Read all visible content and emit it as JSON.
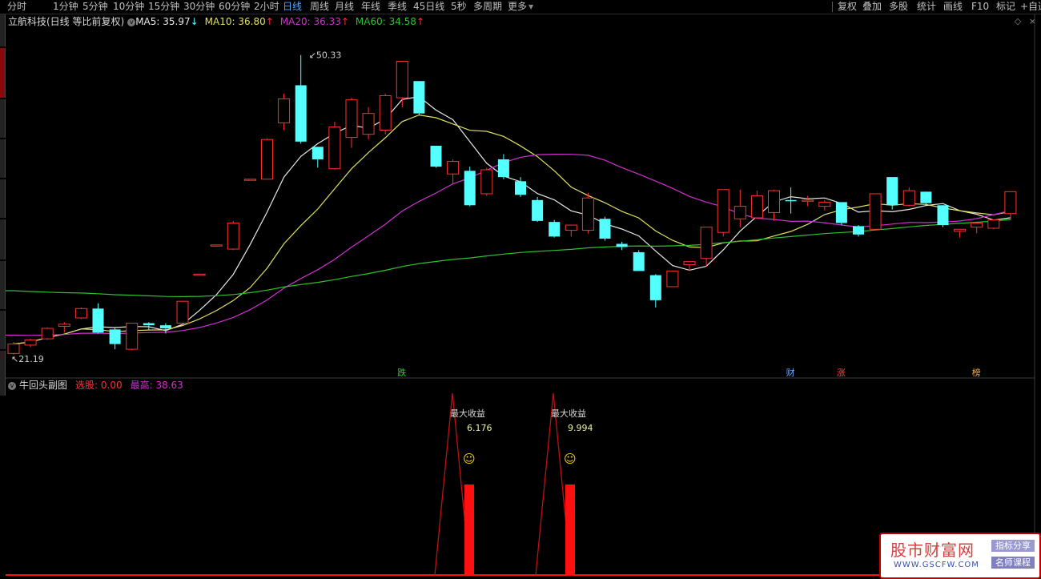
{
  "toolbar": {
    "periods": [
      "分时",
      "1分钟",
      "5分钟",
      "10分钟",
      "15分钟",
      "30分钟",
      "60分钟",
      "2小时",
      "日线",
      "周线",
      "月线",
      "年线",
      "季线",
      "45日线",
      "5秒",
      "多周期",
      "更多"
    ],
    "active_period": "日线",
    "right_buttons": [
      "复权",
      "叠加",
      "多股",
      "统计",
      "画线",
      "F10",
      "标记",
      "+自选"
    ]
  },
  "stock": {
    "name": "立航科技(日线 等比前复权)",
    "ma5_label": "MA5: 35.97",
    "ma5_arrow": "↓",
    "ma10_label": "MA10: 36.80",
    "ma10_arrow": "↑",
    "ma20_label": "MA20: 36.33",
    "ma20_arrow": "↑",
    "ma60_label": "MA60: 34.58",
    "ma60_arrow": "↑"
  },
  "sub_indicator": {
    "name": "牛回头副图",
    "select_label": "选股: 0.00",
    "high_label": "最高: 38.63"
  },
  "colors": {
    "up": "#ff3030",
    "down": "#54ffff",
    "ma5": "#e8e8e8",
    "ma10": "#e0e060",
    "ma20": "#d030d0",
    "ma60": "#30c030",
    "sub_bar": "#ff1010"
  },
  "chart_data": {
    "type": "candlestick",
    "price_range": [
      19.5,
      52.5
    ],
    "high_label": "50.33",
    "low_label": "21.19",
    "candles": [
      [
        21.7,
        22.6,
        21.6,
        22.8
      ],
      [
        22.5,
        23.0,
        22.3,
        23.1
      ],
      [
        23.1,
        24.1,
        23.0,
        24.2
      ],
      [
        24.3,
        24.5,
        23.7,
        24.7
      ],
      [
        25.1,
        26.0,
        25.0,
        26.1
      ],
      [
        26.0,
        23.7,
        23.6,
        26.5
      ],
      [
        24.0,
        22.6,
        22.1,
        24.2
      ],
      [
        22.1,
        24.6,
        22.0,
        24.6
      ],
      [
        24.6,
        24.4,
        23.9,
        24.7
      ],
      [
        24.4,
        24.1,
        23.6,
        24.6
      ],
      [
        24.6,
        26.7,
        24.4,
        26.7
      ],
      [
        29.3,
        29.3,
        29.3,
        29.3
      ],
      [
        32.1,
        32.1,
        32.1,
        32.1
      ],
      [
        31.7,
        34.2,
        31.6,
        34.4
      ],
      [
        38.4,
        38.4,
        38.4,
        38.4
      ],
      [
        38.4,
        42.2,
        38.4,
        42.3
      ],
      [
        43.8,
        46.1,
        43.1,
        46.6
      ],
      [
        47.4,
        42.0,
        41.8,
        50.3
      ],
      [
        41.5,
        40.3,
        39.5,
        41.5
      ],
      [
        39.4,
        43.4,
        39.3,
        43.9
      ],
      [
        42.4,
        46.0,
        41.4,
        46.2
      ],
      [
        42.7,
        44.7,
        42.2,
        45.3
      ],
      [
        43.1,
        46.4,
        42.7,
        46.6
      ],
      [
        46.2,
        49.7,
        45.3,
        49.7
      ],
      [
        47.8,
        44.7,
        44.6,
        47.8
      ],
      [
        41.6,
        39.6,
        39.5,
        41.6
      ],
      [
        38.9,
        40.1,
        37.9,
        40.3
      ],
      [
        39.2,
        35.9,
        35.8,
        39.6
      ],
      [
        37.0,
        39.3,
        36.8,
        39.5
      ],
      [
        40.3,
        38.6,
        38.4,
        40.8
      ],
      [
        38.2,
        36.9,
        36.7,
        38.6
      ],
      [
        36.4,
        34.4,
        34.3,
        36.7
      ],
      [
        34.3,
        32.9,
        32.8,
        34.5
      ],
      [
        33.5,
        34.0,
        32.9,
        34.0
      ],
      [
        33.5,
        36.6,
        33.2,
        37.1
      ],
      [
        34.6,
        32.7,
        32.5,
        34.8
      ],
      [
        32.2,
        31.9,
        31.6,
        32.4
      ],
      [
        31.4,
        29.6,
        29.6,
        31.6
      ],
      [
        29.2,
        26.8,
        26.1,
        29.3
      ],
      [
        28.1,
        29.6,
        28.1,
        29.6
      ],
      [
        30.2,
        30.5,
        29.6,
        30.5
      ],
      [
        30.8,
        33.8,
        30.0,
        33.8
      ],
      [
        33.3,
        37.4,
        32.9,
        37.4
      ],
      [
        34.6,
        35.8,
        33.8,
        37.4
      ],
      [
        34.7,
        36.8,
        34.7,
        37.3
      ],
      [
        35.2,
        37.3,
        34.4,
        37.4
      ],
      [
        36.4,
        36.3,
        35.1,
        37.6
      ],
      [
        36.4,
        36.4,
        35.8,
        36.8
      ],
      [
        35.8,
        36.2,
        35.4,
        36.4
      ],
      [
        36.2,
        34.2,
        34.0,
        36.2
      ],
      [
        33.9,
        33.1,
        32.9,
        34.0
      ],
      [
        33.6,
        37.0,
        33.6,
        37.0
      ],
      [
        38.6,
        35.9,
        35.5,
        38.6
      ],
      [
        35.9,
        37.3,
        35.8,
        37.6
      ],
      [
        37.2,
        36.1,
        36.0,
        37.2
      ],
      [
        35.9,
        34.0,
        33.8,
        35.9
      ],
      [
        33.4,
        33.6,
        32.8,
        33.6
      ],
      [
        33.8,
        34.2,
        33.2,
        34.2
      ],
      [
        33.7,
        34.5,
        33.6,
        34.5
      ],
      [
        35.1,
        37.2,
        34.5,
        37.2
      ]
    ],
    "markers": [
      {
        "text": "跌",
        "color": "#30d030",
        "index": 23
      },
      {
        "text": "财",
        "color": "#6fa8ff",
        "index": 46
      },
      {
        "text": "涨",
        "color": "#ff4040",
        "index": 49
      },
      {
        "text": "榜",
        "color": "#ffb030",
        "index": 57
      }
    ],
    "sub_signals": [
      {
        "label": "最大收益",
        "value": "6.176",
        "icon": "☺"
      },
      {
        "label": "最大收益",
        "value": "9.994",
        "icon": "☺"
      }
    ]
  },
  "watermark": {
    "title": "股市财富网",
    "url": "WWW.GSCFW.COM",
    "tag1": "指标分享",
    "tag2": "名师课程"
  }
}
